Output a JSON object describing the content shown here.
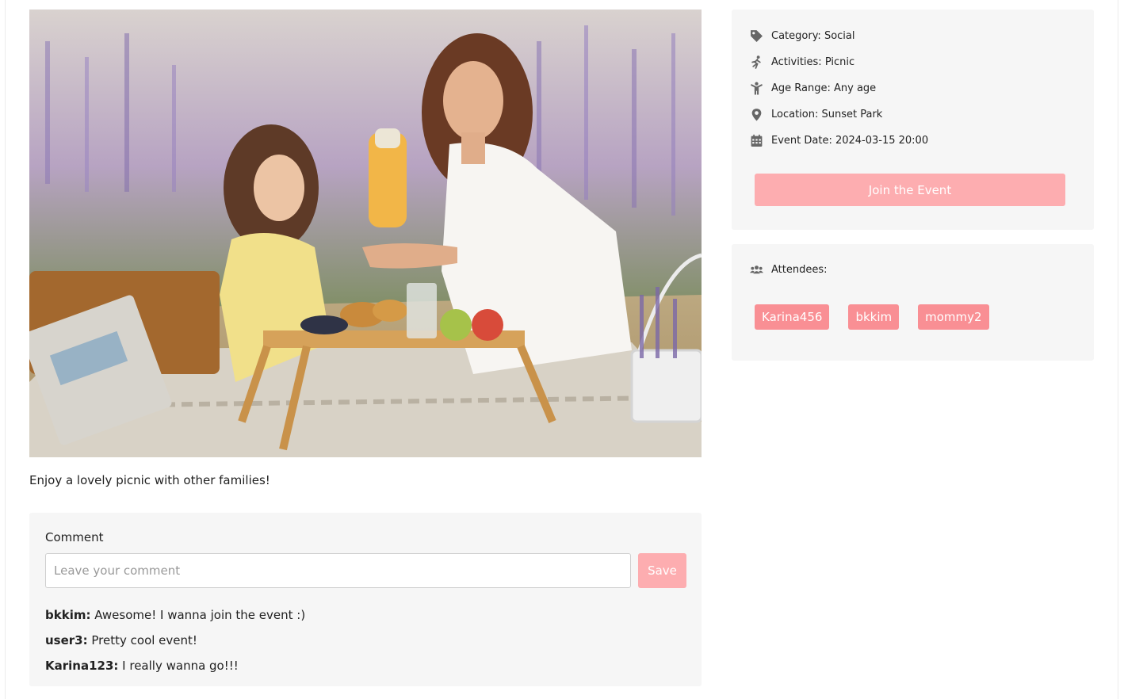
{
  "event": {
    "description": "Enjoy a lovely picnic with other families!"
  },
  "info": {
    "category": "Category: Social",
    "activities": "Activities: Picnic",
    "age_range": "Age Range: Any age",
    "location": "Location: Sunset Park",
    "event_date": "Event Date: 2024-03-15 20:00",
    "join_label": "Join the Event",
    "icons": [
      "tag-icon",
      "running-icon",
      "child-icon",
      "map-pin-icon",
      "calendar-icon"
    ]
  },
  "attendees": {
    "title": "Attendees:",
    "icon": "users-icon",
    "list": [
      "Karina456",
      "bkkim",
      "mommy2"
    ]
  },
  "comments": {
    "label": "Comment",
    "placeholder": "Leave your comment",
    "save_label": "Save",
    "items": [
      {
        "user": "bkkim:",
        "text": " Awesome! I wanna join the event :)"
      },
      {
        "user": "user3:",
        "text": " Pretty cool event!"
      },
      {
        "user": "Karina123:",
        "text": " I really wanna go!!!"
      }
    ]
  },
  "colors": {
    "accent_button": "#fdadb0",
    "attendee_tag": "#f98f94",
    "card_bg": "#f6f6f6",
    "icon": "#666666"
  }
}
